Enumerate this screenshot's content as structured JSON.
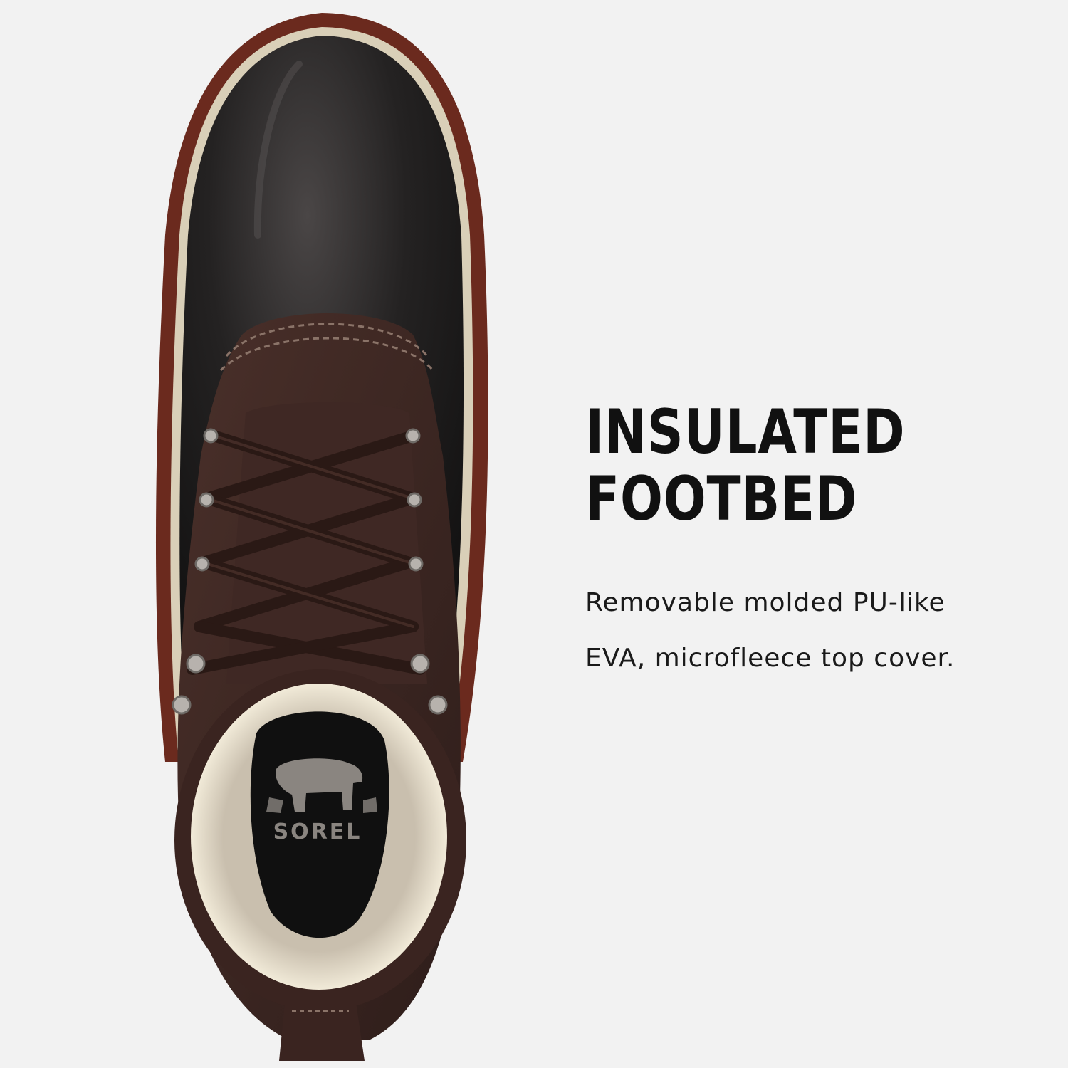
{
  "headline": {
    "line1": "INSULATED",
    "line2": "FOOTBED"
  },
  "description": {
    "line1": "Removable molded PU-like",
    "line2": "EVA, microfleece top cover."
  },
  "logo": {
    "brand": "SOREL",
    "icon": "polar-bear-icon"
  },
  "colors": {
    "background": "#f2f2f2",
    "boot_shell": "#1e1c1c",
    "sole": "#6b2a1e",
    "suede": "#3b2622",
    "lining": "#e8dfcc",
    "text": "#111111"
  }
}
